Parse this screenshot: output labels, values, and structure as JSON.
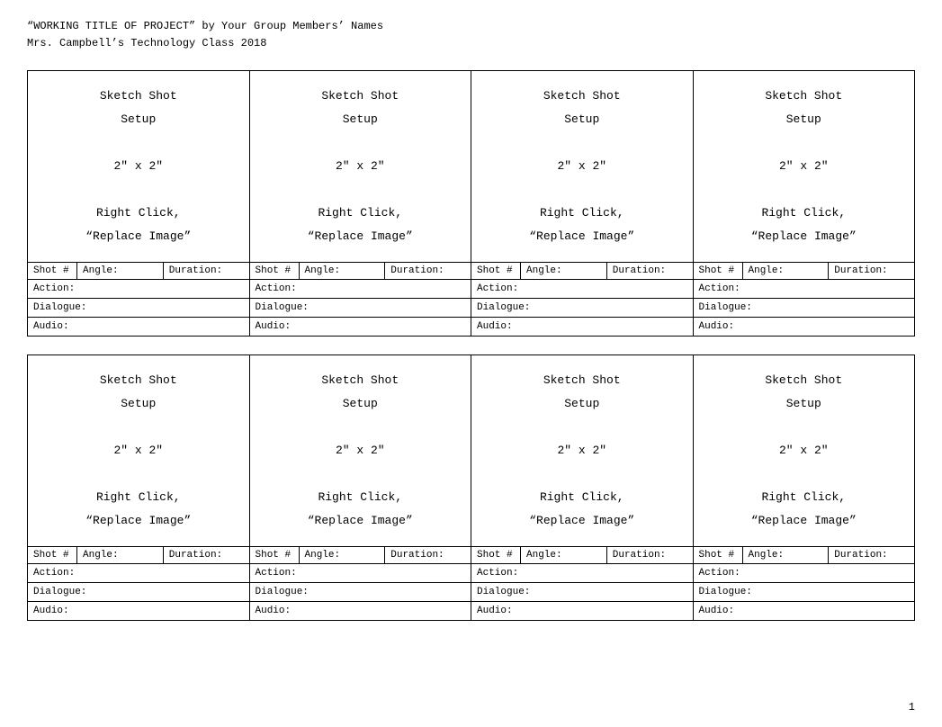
{
  "header": {
    "line1": "“WORKING TITLE OF PROJECT” by Your Group Members’ Names",
    "line2": "Mrs. Campbell’s Technology Class 2018"
  },
  "shot_placeholder": {
    "title": "Sketch Shot\nSetup",
    "size": "2″ x 2″",
    "instruction": "Right Click,\n“Replace Image”"
  },
  "labels": {
    "shot_num": "Shot #",
    "angle": "Angle:",
    "duration": "Duration:",
    "action": "Action:",
    "dialogue": "Dialogue:",
    "audio": "Audio:"
  },
  "sections": [
    {
      "id": "section-1",
      "shots": [
        {
          "id": "shot-1-1"
        },
        {
          "id": "shot-1-2"
        },
        {
          "id": "shot-1-3"
        },
        {
          "id": "shot-1-4"
        }
      ]
    },
    {
      "id": "section-2",
      "shots": [
        {
          "id": "shot-2-1"
        },
        {
          "id": "shot-2-2"
        },
        {
          "id": "shot-2-3"
        },
        {
          "id": "shot-2-4"
        }
      ]
    }
  ],
  "page_number": "1"
}
